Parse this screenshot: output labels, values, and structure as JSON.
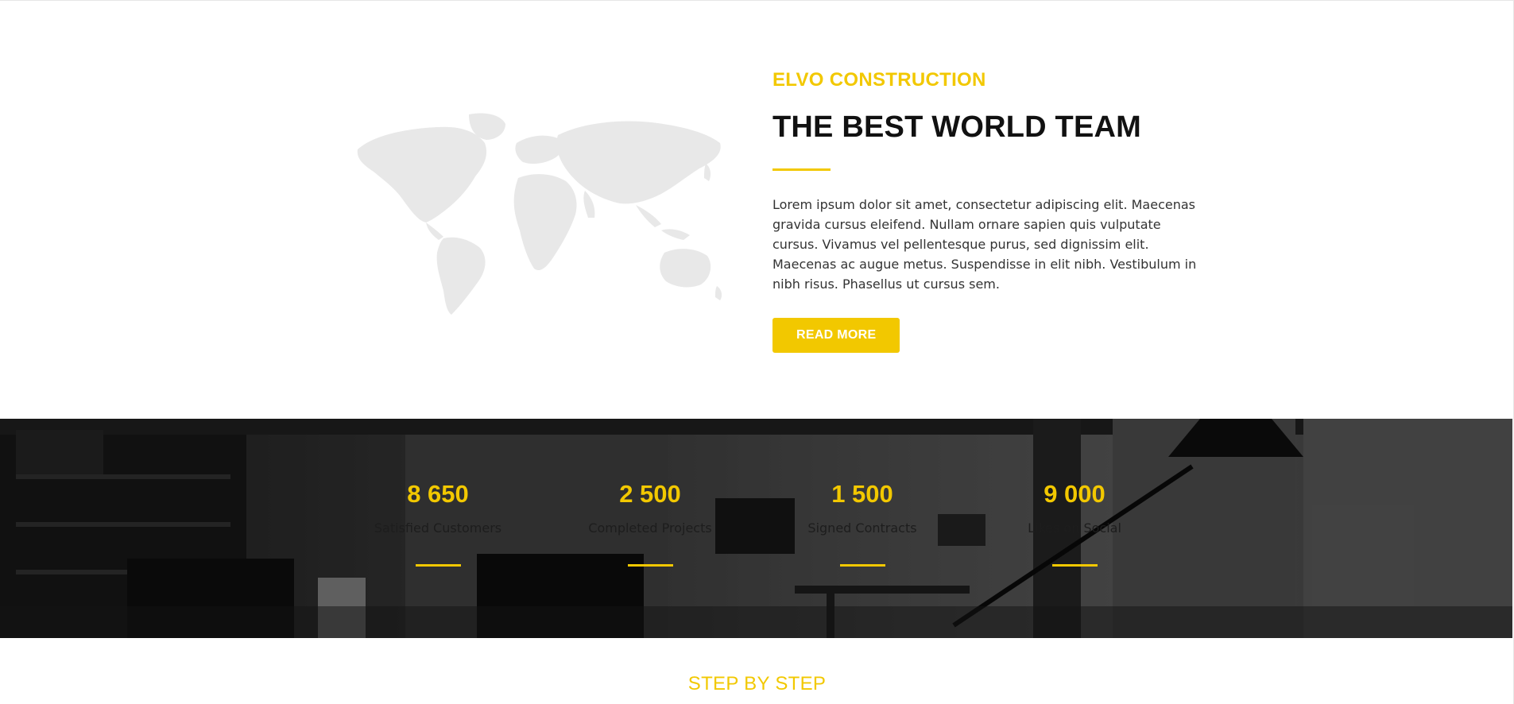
{
  "about": {
    "eyebrow": "ELVO CONSTRUCTION",
    "headline": "THE BEST WORLD TEAM",
    "body": "Lorem ipsum dolor sit amet, consectetur adipiscing elit. Maecenas gravida cursus eleifend. Nullam ornare sapien quis vulputate cursus. Vivamus vel pellentesque purus, sed dignissim elit. Maecenas ac augue metus. Suspendisse in elit nibh. Vestibulum in nibh risus. Phasellus ut cursus sem.",
    "button_label": "READ MORE",
    "map_icon": "world-map-icon"
  },
  "stats": [
    {
      "number": "8 650",
      "label": "Satisfied Customers"
    },
    {
      "number": "2 500",
      "label": "Completed Projects"
    },
    {
      "number": "1 500",
      "label": "Signed Contracts"
    },
    {
      "number": "9 000",
      "label": "Likes on Social"
    }
  ],
  "step": {
    "title": "STEP BY STEP"
  },
  "colors": {
    "accent": "#f2c800",
    "heading": "#111111",
    "map": "#e8e8e8"
  }
}
